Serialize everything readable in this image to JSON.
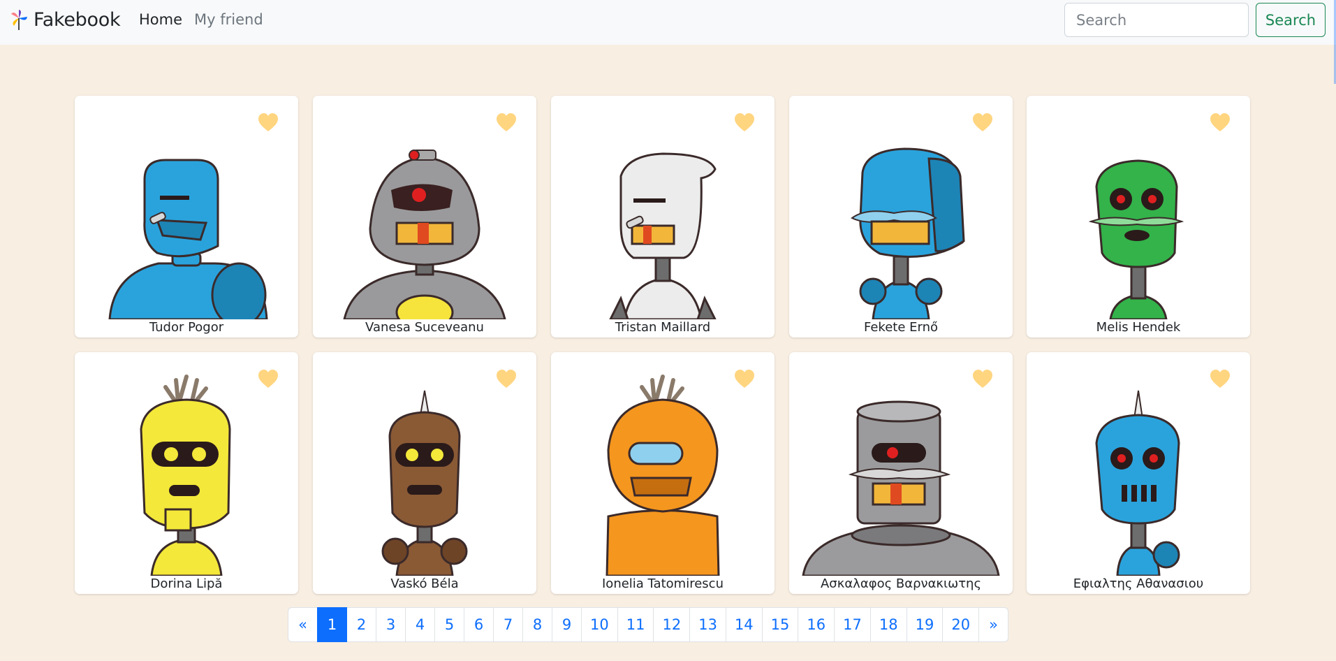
{
  "app": {
    "brand": "Fakebook",
    "nav": {
      "home": "Home",
      "friend": "My friend"
    },
    "search": {
      "placeholder": "Search",
      "button": "Search"
    }
  },
  "colors": {
    "accent": "#0d6efd",
    "heart": "#ffd580",
    "search_green": "#198754",
    "page_bg": "#f8eee2"
  },
  "friends": [
    {
      "name": "Tudor Pogor",
      "icon": "blue-robot-icon",
      "color": "#2aa3dc"
    },
    {
      "name": "Vanesa Suceveanu",
      "icon": "gray-cyclops-robot-icon",
      "color": "#9a9a9c"
    },
    {
      "name": "Tristan Maillard",
      "icon": "white-robot-icon",
      "color": "#ececec"
    },
    {
      "name": "Fekete Ernő",
      "icon": "blue-mustache-robot-icon",
      "color": "#2aa3dc"
    },
    {
      "name": "Melis Hendek",
      "icon": "green-robot-icon",
      "color": "#33b34a"
    },
    {
      "name": "Dorina Lipă",
      "icon": "yellow-robot-icon",
      "color": "#f4e83a"
    },
    {
      "name": "Vaskó Béla",
      "icon": "brown-robot-icon",
      "color": "#8a5a35"
    },
    {
      "name": "Ionelia Tatomirescu",
      "icon": "orange-robot-icon",
      "color": "#f5961e"
    },
    {
      "name": "Ασκαλαφος Βαρνακιωτης",
      "icon": "gray-canister-robot-icon",
      "color": "#9b9b9d"
    },
    {
      "name": "Εφιαλτης Αθανασιου",
      "icon": "blue-spike-robot-icon",
      "color": "#2aa3dc"
    }
  ],
  "pagination": {
    "prev": "«",
    "next": "»",
    "current": "1",
    "pages": [
      "1",
      "2",
      "3",
      "4",
      "5",
      "6",
      "7",
      "8",
      "9",
      "10",
      "11",
      "12",
      "13",
      "14",
      "15",
      "16",
      "17",
      "18",
      "19",
      "20"
    ]
  }
}
